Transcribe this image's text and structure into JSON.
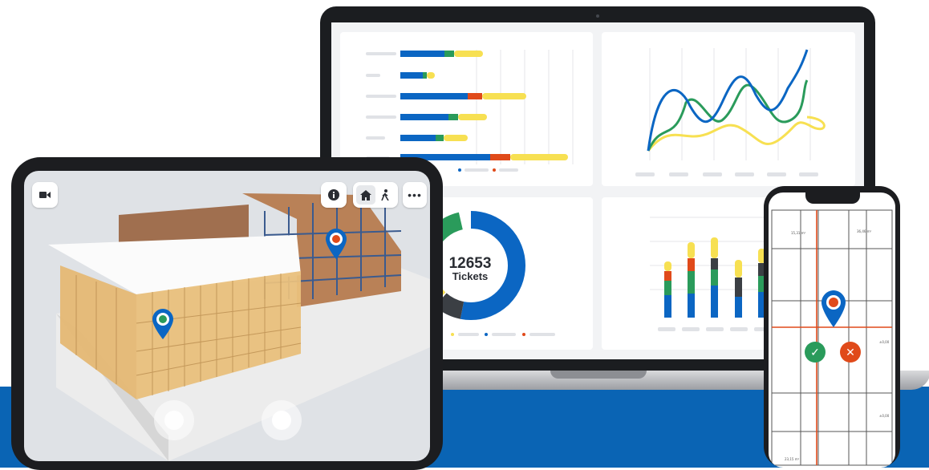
{
  "colors": {
    "blue": "#0a64b4",
    "brand_blue": "#0b66c3",
    "green": "#2a9b5b",
    "yellow": "#f7e052",
    "red": "#e04a1a",
    "dark": "#3b3f44"
  },
  "dashboard": {
    "donut": {
      "total": "12653",
      "label": "Tickets"
    }
  },
  "tablet": {
    "icons": [
      "video-icon",
      "info-icon",
      "home-icon",
      "walk-icon",
      "more-icon"
    ]
  },
  "phone": {
    "rooms": [
      "15,31 m²",
      "36,46 m²",
      "23,15 m²",
      "±0,00",
      "±0,00"
    ],
    "actions": {
      "confirm": "✓",
      "reject": "✕"
    }
  }
}
